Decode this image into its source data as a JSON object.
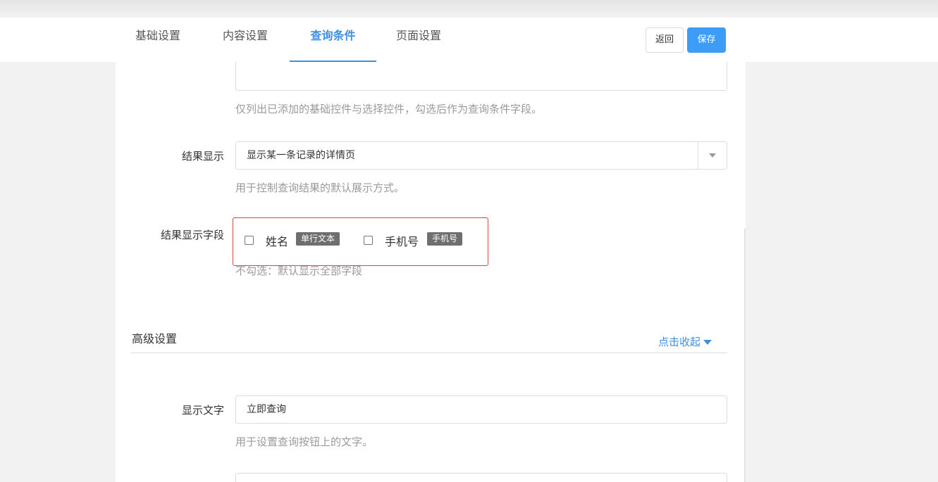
{
  "tabs": [
    {
      "label": "基础设置"
    },
    {
      "label": "内容设置"
    },
    {
      "label": "查询条件"
    },
    {
      "label": "页面设置"
    }
  ],
  "actions": {
    "back_label": "返回",
    "save_label": "保存"
  },
  "query_fields": {
    "hint": "仅列出已添加的基础控件与选择控件，勾选后作为查询条件字段。"
  },
  "result_display": {
    "label": "结果显示",
    "value": "显示某一条记录的详情页",
    "hint": "用于控制查询结果的默认展示方式。"
  },
  "result_fields": {
    "label": "结果显示字段",
    "items": [
      {
        "name": "姓名",
        "tag": "单行文本",
        "checked": false
      },
      {
        "name": "手机号",
        "tag": "手机号",
        "checked": false
      }
    ],
    "hint": "不勾选：默认显示全部字段"
  },
  "advanced": {
    "title": "高级设置",
    "collapse_label": "点击收起"
  },
  "display_text": {
    "label": "显示文字",
    "value": "立即查询",
    "hint": "用于设置查询按钮上的文字。"
  },
  "colors": {
    "accent": "#3d8fe0",
    "save_button": "#3d9cf5",
    "highlight_border": "#e04040",
    "tag_bg": "#6e6e6e"
  }
}
